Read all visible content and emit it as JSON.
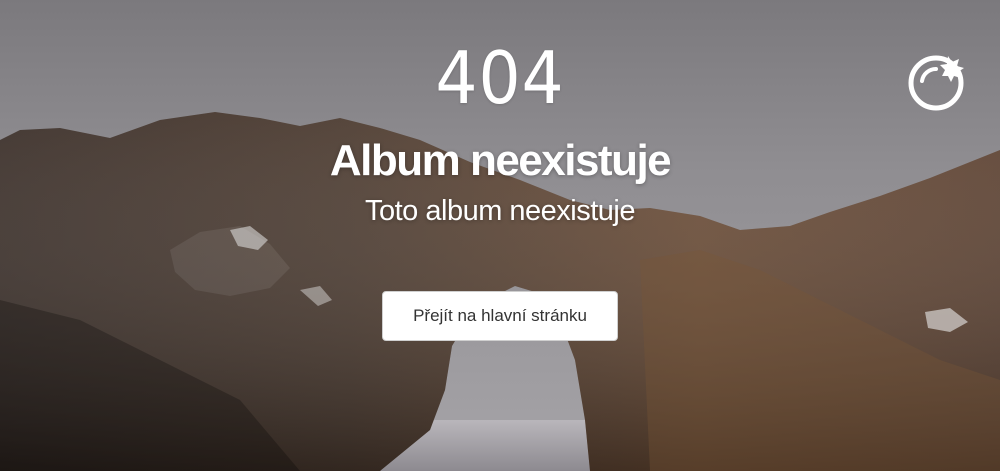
{
  "error": {
    "code": "404",
    "title": "Album neexistuje",
    "message": "Toto album neexistuje"
  },
  "actions": {
    "home_label": "Přejít na hlavní stránku"
  },
  "brand": {
    "logo_icon": "pomegranate-logo-icon"
  },
  "colors": {
    "text": "#ffffff",
    "button_bg": "#ffffff",
    "button_text": "#333333",
    "sky": "#8e8c8f",
    "rock": "#4a3a2e"
  }
}
